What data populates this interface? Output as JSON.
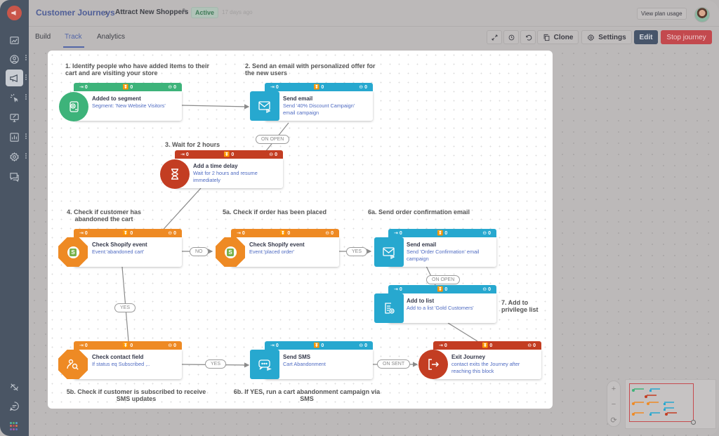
{
  "sidebar": {
    "logo_icon": "megaphone-icon",
    "items": [
      {
        "name": "dashboard",
        "icon": "dashboard-icon"
      },
      {
        "name": "contacts",
        "icon": "contacts-icon"
      },
      {
        "name": "campaigns",
        "icon": "megaphone-icon",
        "active": true
      },
      {
        "name": "automation",
        "icon": "magic-click-icon"
      },
      {
        "name": "website",
        "icon": "monitor-edit-icon"
      },
      {
        "name": "reports",
        "icon": "bar-chart-icon"
      },
      {
        "name": "settings",
        "icon": "gear-icon"
      },
      {
        "name": "conversations",
        "icon": "chat-icon"
      }
    ],
    "bottom": [
      {
        "name": "integrations",
        "icon": "plug-icon"
      },
      {
        "name": "help",
        "icon": "help-chat-icon"
      },
      {
        "name": "apps",
        "icon": "apps-grid-icon"
      }
    ]
  },
  "header": {
    "breadcrumb_root": "Customer Journeys",
    "breadcrumb_sep": "›",
    "journey_name": "Attract New Shoppers",
    "status": "Active",
    "updated": "17 days ago",
    "plan_button": "View plan usage"
  },
  "tabs": [
    {
      "label": "Build"
    },
    {
      "label": "Track",
      "active": true
    },
    {
      "label": "Analytics"
    }
  ],
  "toolbar": {
    "expand_icon": "expand-icon",
    "history_icon": "history-icon",
    "undo_icon": "undo-icon",
    "clone": "Clone",
    "settings": "Settings",
    "edit": "Edit",
    "stop": "Stop journey"
  },
  "colors": {
    "green": "#3db37a",
    "blue": "#27a8cf",
    "red": "#c33d22",
    "orange": "#ee8a24"
  },
  "notes": {
    "n1": "1. Identify people who have added items to their cart and are visiting your store",
    "n2": "2. Send an email with personalized offer for the new users",
    "n3": "3. Wait for 2 hours",
    "n4": "4. Check if customer has abandoned the cart",
    "n5a": "5a. Check if order has been placed",
    "n6a": "6a. Send order confirmation email",
    "n7": "7. Add to privilege list",
    "n5b": "5b. Check if customer is subscribed to receive SMS updates",
    "n6b": "6b. If YES, run a cart abandonment campaign via SMS"
  },
  "nodes": [
    {
      "id": "segment",
      "title": "Added to segment",
      "desc": "Segment: 'New Website Visitors'",
      "icon": "segment-add-icon",
      "color": "green",
      "stats": {
        "entered": "0",
        "waiting": "0",
        "exited": "0"
      }
    },
    {
      "id": "email1",
      "title": "Send email",
      "desc": "Send '40% Discount Campaign' email campaign",
      "icon": "email-send-icon",
      "color": "blue",
      "stats": {
        "entered": "0",
        "waiting": "0",
        "exited": "0"
      }
    },
    {
      "id": "delay",
      "title": "Add a time delay",
      "desc": "Wait for 2 hours and resume immediately",
      "icon": "hourglass-icon",
      "color": "red",
      "stats": {
        "entered": "0",
        "waiting": "0",
        "exited": "0"
      }
    },
    {
      "id": "shopify1",
      "title": "Check Shopify event",
      "desc": "Event:'abandoned cart'",
      "icon": "shopify-icon",
      "color": "orange",
      "stats": {
        "entered": "0",
        "waiting": "0",
        "exited": "0"
      }
    },
    {
      "id": "shopify2",
      "title": "Check Shopify event",
      "desc": "Event:'placed order'",
      "icon": "shopify-icon",
      "color": "orange",
      "stats": {
        "entered": "0",
        "waiting": "0",
        "exited": "0"
      }
    },
    {
      "id": "email2",
      "title": "Send email",
      "desc": "Send 'Order Confirmation' email campaign",
      "icon": "email-send-icon",
      "color": "blue",
      "stats": {
        "entered": "0",
        "waiting": "0",
        "exited": "0"
      }
    },
    {
      "id": "list",
      "title": "Add to list",
      "desc": "Add to a list 'Gold Customers'",
      "icon": "list-add-icon",
      "color": "blue",
      "stats": {
        "entered": "0",
        "waiting": "0",
        "exited": "0"
      }
    },
    {
      "id": "contact",
      "title": "Check contact field",
      "desc": "If status eq Subscribed ,..",
      "icon": "contact-search-icon",
      "color": "orange",
      "stats": {
        "entered": "0",
        "waiting": "0",
        "exited": "0"
      }
    },
    {
      "id": "sms",
      "title": "Send SMS",
      "desc": "Cart Abandonment",
      "icon": "sms-icon",
      "color": "blue",
      "stats": {
        "entered": "0",
        "waiting": "0",
        "exited": "0"
      }
    },
    {
      "id": "exit",
      "title": "Exit Journey",
      "desc": "contact exits the Journey after reaching this block",
      "icon": "exit-icon",
      "color": "red",
      "stats": {
        "entered": "0",
        "waiting": "0",
        "exited": "0"
      }
    }
  ],
  "connectors": {
    "on_open_1": "ON OPEN",
    "no": "NO",
    "yes_1": "YES",
    "on_open_2": "ON OPEN",
    "yes_2": "YES",
    "yes_3": "YES",
    "on_sent": "ON SENT"
  },
  "zoom_controls": {
    "zoom_in": "+",
    "zoom_out": "−",
    "reset": "⟳"
  }
}
